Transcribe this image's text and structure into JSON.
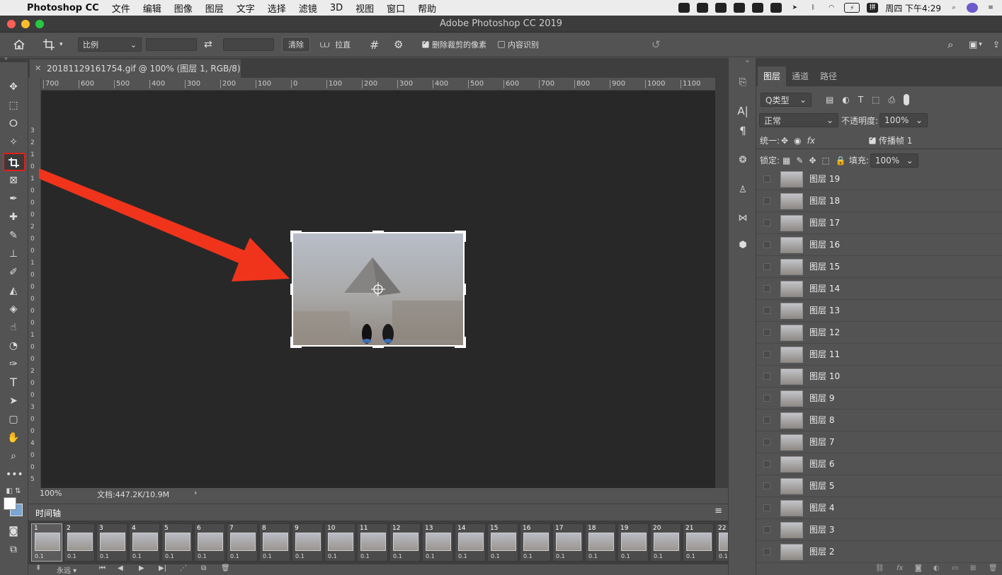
{
  "menubar": {
    "app_name": "Photoshop CC",
    "items": [
      "文件",
      "编辑",
      "图像",
      "图层",
      "文字",
      "选择",
      "滤镜",
      "3D",
      "视图",
      "窗口",
      "帮助"
    ],
    "clock": "周四 下午4:29"
  },
  "window": {
    "title": "Adobe Photoshop CC 2019"
  },
  "options": {
    "ratio_select": "比例",
    "clear_button": "清除",
    "straighten_label": "拉直",
    "delete_cropped_label": "删除裁剪的像素",
    "delete_cropped_checked": true,
    "content_aware_label": "内容识别",
    "content_aware_checked": false
  },
  "document": {
    "tab_title": "20181129161754.gif @ 100% (图层 1, RGB/8)",
    "zoom": "100%",
    "doc_info": "文档:447.2K/10.9M"
  },
  "ruler_h": [
    "700",
    "600",
    "500",
    "400",
    "300",
    "200",
    "100",
    "0",
    "100",
    "200",
    "300",
    "400",
    "500",
    "600",
    "700",
    "800",
    "900",
    "1000",
    "1100"
  ],
  "ruler_v": [
    "3",
    "2",
    "1",
    "0",
    "1",
    "0",
    "0",
    "0",
    "2",
    "0",
    "0",
    "1",
    "0",
    "0",
    "0",
    "0",
    "0",
    "1",
    "0",
    "0",
    "2",
    "0",
    "0",
    "3",
    "0",
    "0",
    "4",
    "0",
    "0",
    "5",
    "0"
  ],
  "timeline": {
    "title": "时间轴",
    "frame_delay": "0.1",
    "loop_label": "永远",
    "frames": [
      "1",
      "2",
      "3",
      "4",
      "5",
      "6",
      "7",
      "8",
      "9",
      "10",
      "11",
      "12",
      "13",
      "14",
      "15",
      "16",
      "17",
      "18",
      "19",
      "20",
      "21",
      "22"
    ]
  },
  "layers_panel": {
    "tabs": [
      "图层",
      "通道",
      "路径"
    ],
    "filter_label": "Q类型",
    "blend_mode": "正常",
    "opacity_label": "不透明度:",
    "opacity_value": "100%",
    "unify_label": "统一:",
    "propagate_label": "传播帧 1",
    "lock_label": "锁定:",
    "fill_label": "填充:",
    "fill_value": "100%",
    "layers": [
      "图层 19",
      "图层 18",
      "图层 17",
      "图层 16",
      "图层 15",
      "图层 14",
      "图层 13",
      "图层 12",
      "图层 11",
      "图层 10",
      "图层 9",
      "图层 8",
      "图层 7",
      "图层 6",
      "图层 5",
      "图层 4",
      "图层 3",
      "图层 2"
    ]
  },
  "colors": {
    "annotation_arrow": "#f0341c",
    "crop_highlight": "#e0201a"
  }
}
